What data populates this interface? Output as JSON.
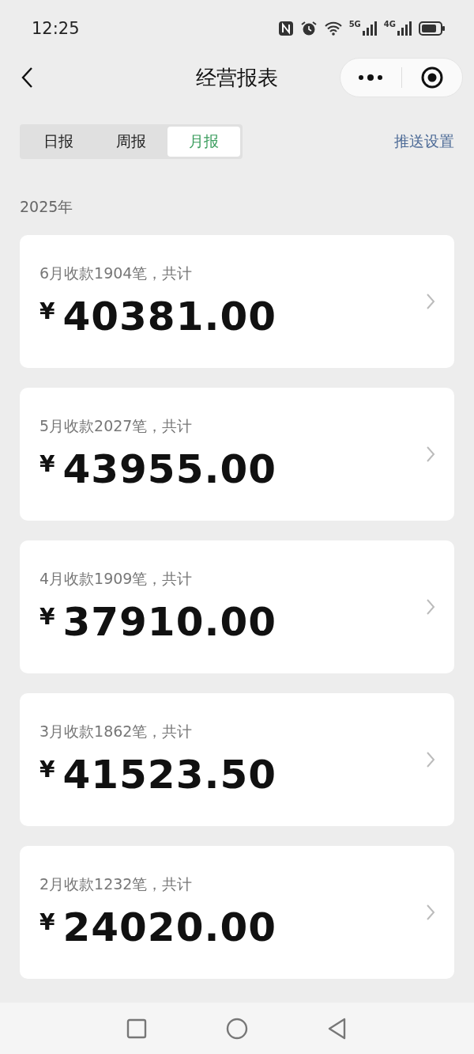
{
  "status_bar": {
    "time": "12:25",
    "network_labels": [
      "5G",
      "4G"
    ]
  },
  "nav": {
    "title": "经营报表"
  },
  "tabs": [
    {
      "label": "日报",
      "selected": false
    },
    {
      "label": "周报",
      "selected": false
    },
    {
      "label": "月报",
      "selected": true
    }
  ],
  "push_settings": "推送设置",
  "year": "2025年",
  "records": [
    {
      "label": "6月收款1904笔，共计",
      "currency": "¥",
      "amount": "40381.00"
    },
    {
      "label": "5月收款2027笔，共计",
      "currency": "¥",
      "amount": "43955.00"
    },
    {
      "label": "4月收款1909笔，共计",
      "currency": "¥",
      "amount": "37910.00"
    },
    {
      "label": "3月收款1862笔，共计",
      "currency": "¥",
      "amount": "41523.50"
    },
    {
      "label": "2月收款1232笔，共计",
      "currency": "¥",
      "amount": "24020.00"
    }
  ]
}
